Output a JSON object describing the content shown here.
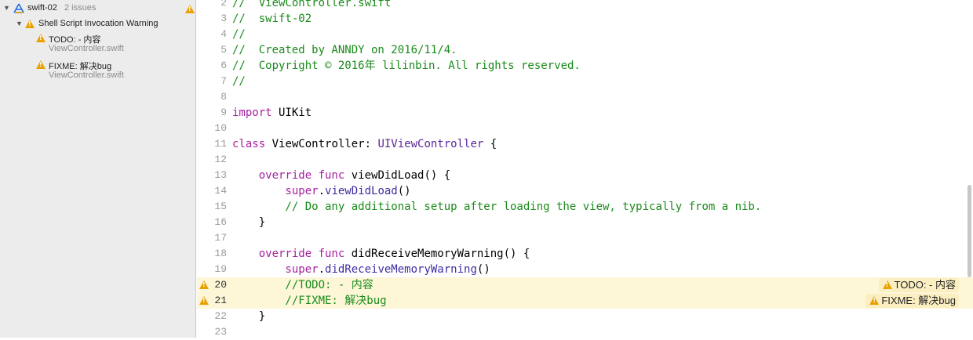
{
  "navigator": {
    "project_name": "swift-02",
    "issue_count": "2 issues",
    "group_title": "Shell Script Invocation Warning",
    "issues": [
      {
        "title": "TODO: - 内容",
        "file": "ViewController.swift"
      },
      {
        "title": "FIXME: 解决bug",
        "file": "ViewController.swift"
      }
    ]
  },
  "editor": {
    "lines": [
      {
        "num": "2",
        "parts": [
          {
            "t": "//  ViewController.swift",
            "c": "cm"
          }
        ]
      },
      {
        "num": "3",
        "parts": [
          {
            "t": "//  swift-02",
            "c": "cm"
          }
        ]
      },
      {
        "num": "4",
        "parts": [
          {
            "t": "//",
            "c": "cm"
          }
        ]
      },
      {
        "num": "5",
        "parts": [
          {
            "t": "//  Created by ANNDY on 2016/11/4.",
            "c": "cm"
          }
        ]
      },
      {
        "num": "6",
        "parts": [
          {
            "t": "//  Copyright © 2016年 lilinbin. All rights reserved.",
            "c": "cm"
          }
        ]
      },
      {
        "num": "7",
        "parts": [
          {
            "t": "//",
            "c": "cm"
          }
        ]
      },
      {
        "num": "8",
        "parts": []
      },
      {
        "num": "9",
        "parts": [
          {
            "t": "import",
            "c": "kw"
          },
          {
            "t": " UIKit",
            "c": ""
          }
        ]
      },
      {
        "num": "10",
        "parts": []
      },
      {
        "num": "11",
        "parts": [
          {
            "t": "class",
            "c": "kw"
          },
          {
            "t": " ViewController: ",
            "c": ""
          },
          {
            "t": "UIViewController",
            "c": "ty"
          },
          {
            "t": " {",
            "c": ""
          }
        ]
      },
      {
        "num": "12",
        "parts": []
      },
      {
        "num": "13",
        "parts": [
          {
            "t": "    override func",
            "c": "kw"
          },
          {
            "t": " viewDidLoad() {",
            "c": ""
          }
        ]
      },
      {
        "num": "14",
        "parts": [
          {
            "t": "        super",
            "c": "kw"
          },
          {
            "t": ".",
            "c": ""
          },
          {
            "t": "viewDidLoad",
            "c": "fn"
          },
          {
            "t": "()",
            "c": ""
          }
        ]
      },
      {
        "num": "15",
        "parts": [
          {
            "t": "        // Do any additional setup after loading the view, typically from a nib.",
            "c": "cm"
          }
        ]
      },
      {
        "num": "16",
        "parts": [
          {
            "t": "    }",
            "c": ""
          }
        ]
      },
      {
        "num": "17",
        "parts": []
      },
      {
        "num": "18",
        "parts": [
          {
            "t": "    override func",
            "c": "kw"
          },
          {
            "t": " didReceiveMemoryWarning() {",
            "c": ""
          }
        ]
      },
      {
        "num": "19",
        "parts": [
          {
            "t": "        super",
            "c": "kw"
          },
          {
            "t": ".",
            "c": ""
          },
          {
            "t": "didReceiveMemoryWarning",
            "c": "fn"
          },
          {
            "t": "()",
            "c": ""
          }
        ]
      },
      {
        "num": "20",
        "parts": [
          {
            "t": "        //TODO: - 内容",
            "c": "cm"
          }
        ],
        "warning": "TODO: - 内容"
      },
      {
        "num": "21",
        "parts": [
          {
            "t": "        //FIXME: 解决bug",
            "c": "cm"
          }
        ],
        "warning": "FIXME: 解决bug"
      },
      {
        "num": "22",
        "parts": [
          {
            "t": "    }",
            "c": ""
          }
        ]
      },
      {
        "num": "23",
        "parts": []
      }
    ]
  },
  "colors": {
    "warning": "#e9a100",
    "comment": "#1a8b1a",
    "keyword": "#a6219e",
    "highlight": "#fdf7d8"
  }
}
